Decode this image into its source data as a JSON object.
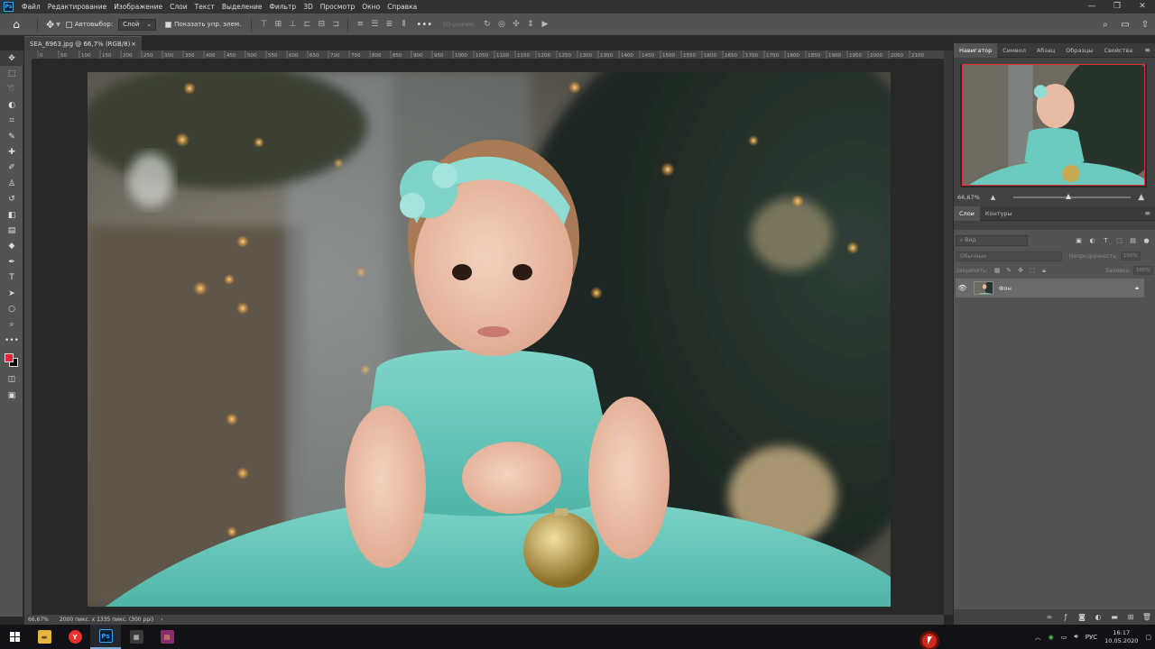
{
  "app": {
    "logo_text": "Ps"
  },
  "menu": [
    "Файл",
    "Редактирование",
    "Изображение",
    "Слои",
    "Текст",
    "Выделение",
    "Фильтр",
    "3D",
    "Просмотр",
    "Окно",
    "Справка"
  ],
  "window_controls": [
    "—",
    "❐",
    "✕"
  ],
  "options": {
    "autoselect_label": "Автовыбор:",
    "autoselect_value": "Слой",
    "show_controls_label": "Показать упр. элем.",
    "mode_3d": "3D-режим:",
    "more": "•••"
  },
  "document": {
    "tab_title": "SEA_6963.jpg @ 66,7% (RGB/8)",
    "tab_close": "×",
    "status_zoom": "66,67%",
    "status_info": "2000 пикс. x 1335 пикс. (300 ppi)",
    "status_arrow": "›"
  },
  "ruler": {
    "ticks": [
      "0",
      "50",
      "100",
      "150",
      "200",
      "250",
      "300",
      "350",
      "400",
      "450",
      "500",
      "550",
      "600",
      "650",
      "700",
      "750",
      "800",
      "850",
      "900",
      "950",
      "1000",
      "1050",
      "1100",
      "1150",
      "1200",
      "1250",
      "1300",
      "1350",
      "1400",
      "1450",
      "1500",
      "1550",
      "1600",
      "1650",
      "1700",
      "1750",
      "1800",
      "1850",
      "1900",
      "1950",
      "2000",
      "2050",
      "2100"
    ]
  },
  "panels": {
    "top_tabs": [
      "Навигатор",
      "Символ",
      "Абзац",
      "Образцы",
      "Свойства"
    ],
    "navigator_zoom": "66,67%",
    "layers_tabs": [
      "Слои",
      "Контуры"
    ],
    "search_placeholder": "Вид",
    "blend_mode": "Обычные",
    "opacity_label": "Непрозрачность:",
    "opacity_value": "100%",
    "lock_label": "Закрепить:",
    "fill_label": "Заливка:",
    "fill_value": "100%",
    "layer_name": "Фон"
  },
  "taskbar": {
    "apps": [
      {
        "name": "explorer",
        "color": "#e6b53a",
        "glyph": "▬"
      },
      {
        "name": "yandex",
        "color": "#e8322e",
        "glyph": "Y"
      },
      {
        "name": "photoshop",
        "color": "#001e36",
        "glyph": "Ps"
      },
      {
        "name": "calculator",
        "color": "#3a3a3a",
        "glyph": "▦"
      },
      {
        "name": "winrar",
        "color": "#8a2d6e",
        "glyph": "▤"
      }
    ],
    "lang": "РУС",
    "time": "16:17",
    "date": "10.05.2020"
  },
  "colors": {
    "foreground": "#e2273a",
    "background": "#000000",
    "accent": "#31a8ff"
  }
}
